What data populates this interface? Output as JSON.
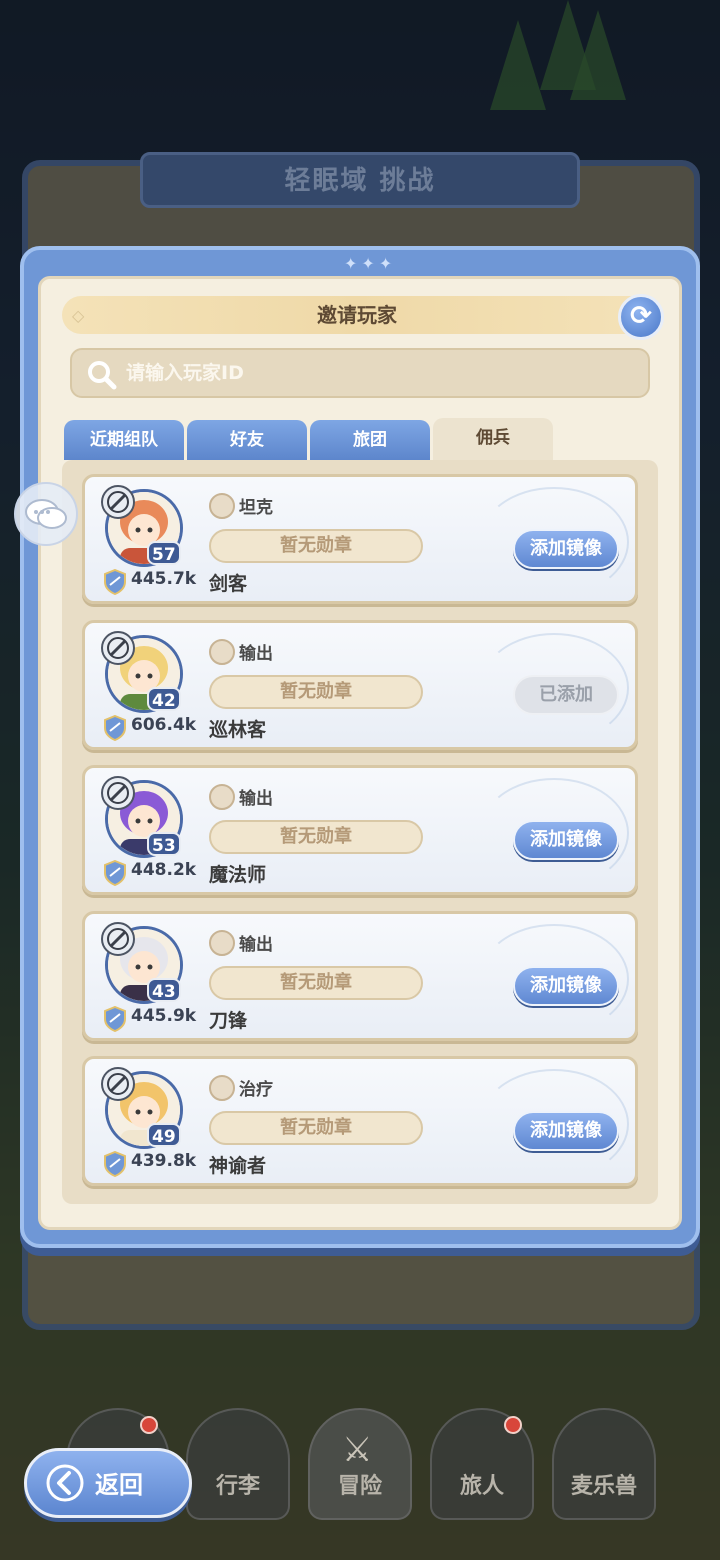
{
  "background": {
    "panel_title": "轻眠域 挑战"
  },
  "dialog": {
    "title": "邀请玩家",
    "refresh_icon": "refresh-icon",
    "search": {
      "placeholder": "请输入玩家ID",
      "value": ""
    },
    "tabs": [
      {
        "label": "近期组队",
        "active": false
      },
      {
        "label": "好友",
        "active": false
      },
      {
        "label": "旅团",
        "active": false
      },
      {
        "label": "佣兵",
        "active": true
      }
    ],
    "players": [
      {
        "level": "57",
        "power": "445.7k",
        "role": "坦克",
        "role_icon": "shield-icon",
        "medal": "暂无勋章",
        "name": "剑客",
        "action": "添加镜像",
        "added": false,
        "hair": "#e98a5a",
        "clothes": "#c9553a"
      },
      {
        "level": "42",
        "power": "606.4k",
        "role": "输出",
        "role_icon": "sword-icon",
        "medal": "暂无勋章",
        "name": "巡林客",
        "action": "已添加",
        "added": true,
        "hair": "#f1d27a",
        "clothes": "#5e8a3e"
      },
      {
        "level": "53",
        "power": "448.2k",
        "role": "输出",
        "role_icon": "sword-icon",
        "medal": "暂无勋章",
        "name": "魔法师",
        "action": "添加镜像",
        "added": false,
        "hair": "#8a5ad6",
        "clothes": "#3a3a6a"
      },
      {
        "level": "43",
        "power": "445.9k",
        "role": "输出",
        "role_icon": "sword-icon",
        "medal": "暂无勋章",
        "name": "刀锋",
        "action": "添加镜像",
        "added": false,
        "hair": "#e6e6ec",
        "clothes": "#3a3048"
      },
      {
        "level": "49",
        "power": "439.8k",
        "role": "治疗",
        "role_icon": "staff-icon",
        "medal": "暂无勋章",
        "name": "神谕者",
        "action": "添加镜像",
        "added": false,
        "hair": "#f2c46a",
        "clothes": "#f1e6cf"
      }
    ]
  },
  "bottom_nav": {
    "back_label": "返回",
    "items": [
      {
        "label": "",
        "icon": "castle-icon",
        "dot": true
      },
      {
        "label": "行李",
        "icon": "backpack-icon",
        "dot": false
      },
      {
        "label": "冒险",
        "icon": "crossed-swords-icon",
        "dot": false
      },
      {
        "label": "旅人",
        "icon": "character-icon",
        "dot": true
      },
      {
        "label": "麦乐兽",
        "icon": "pet-icon",
        "dot": false
      }
    ]
  },
  "colors": {
    "accent_blue": "#6f97d6",
    "panel_cream": "#f5efe0",
    "title_gold": "#efd9a8",
    "notification_red": "#d8463a"
  }
}
